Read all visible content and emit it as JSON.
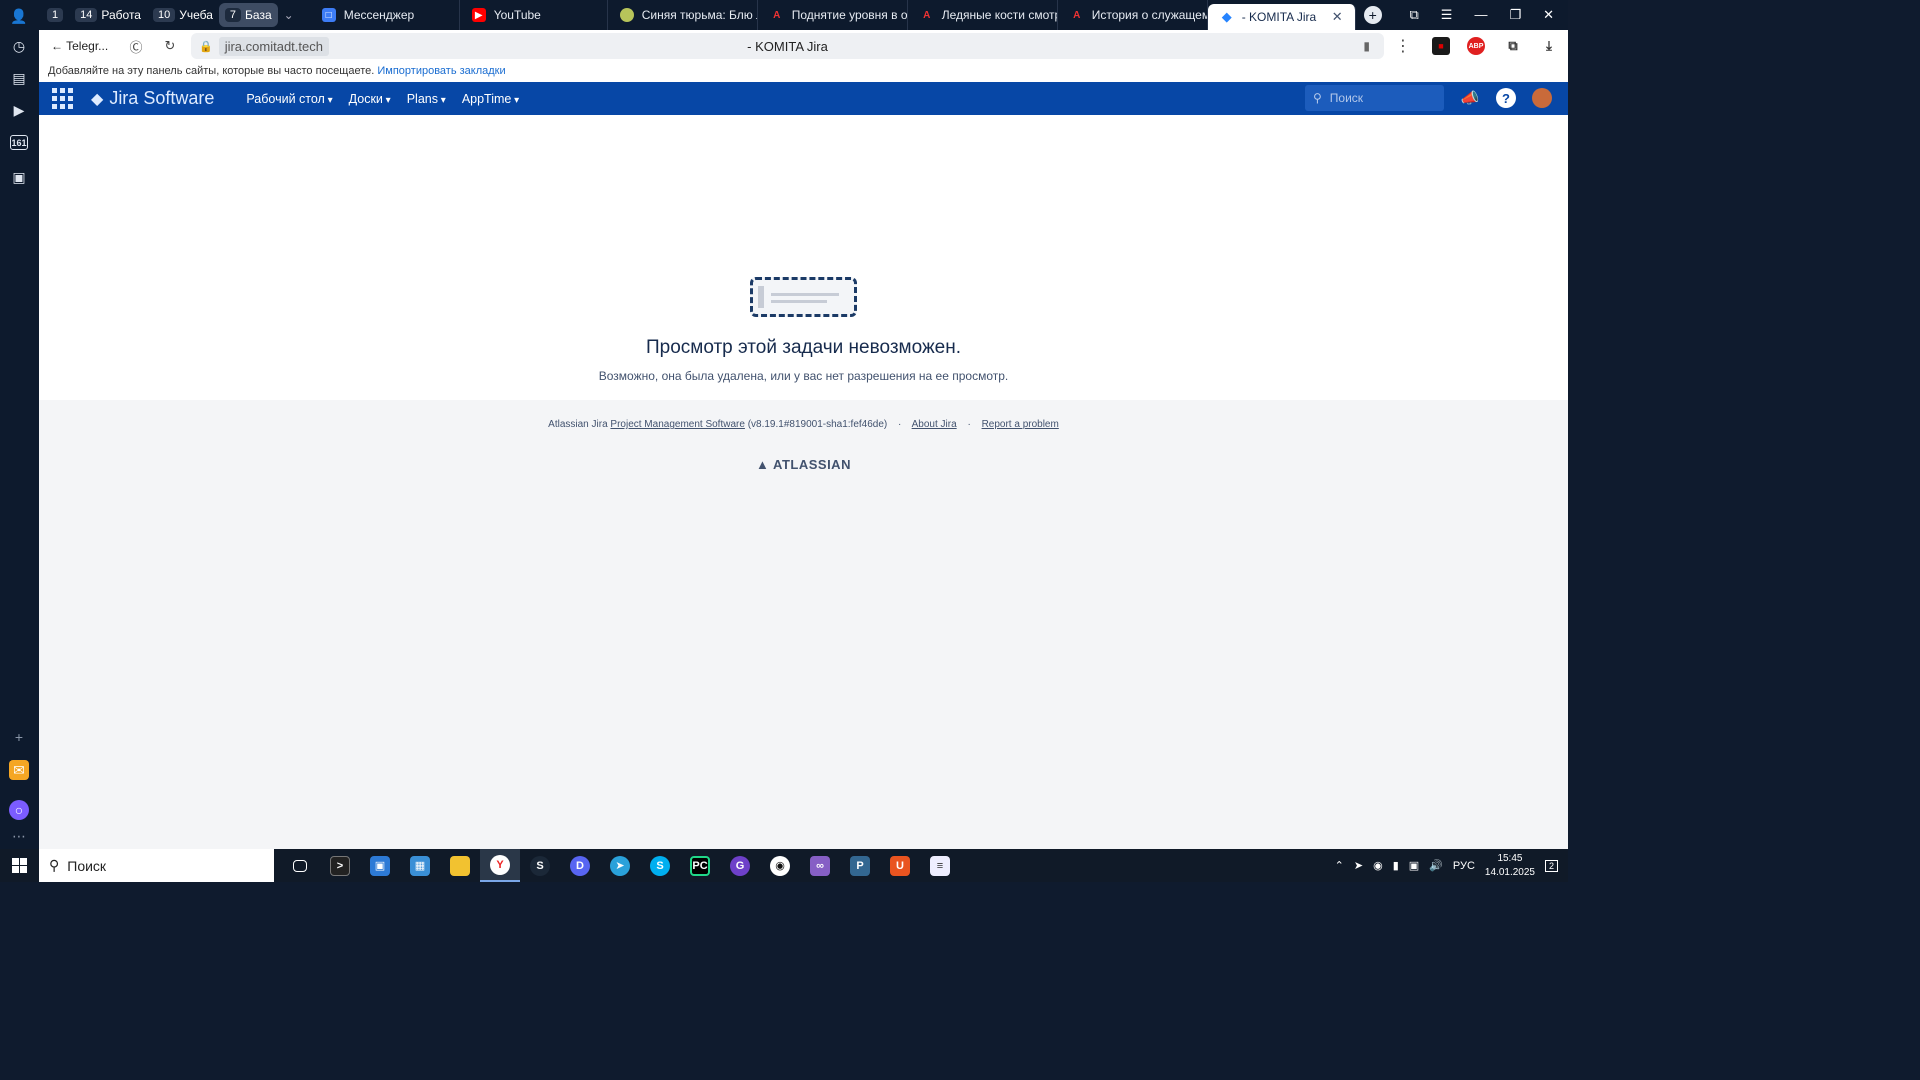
{
  "tabs": {
    "groups": [
      {
        "count": "1",
        "label": ""
      },
      {
        "count": "14",
        "label": "Работа"
      },
      {
        "count": "10",
        "label": "Учеба"
      },
      {
        "count": "7",
        "label": "База"
      }
    ],
    "items": [
      {
        "label": "Мессенджер"
      },
      {
        "label": "YouTube"
      },
      {
        "label": "Синяя тюрьма: Блю Ло"
      },
      {
        "label": "Поднятие уровня в од"
      },
      {
        "label": "Ледяные кости смотре"
      },
      {
        "label": "История о служащем."
      },
      {
        "label": "- KOMITA Jira"
      }
    ]
  },
  "addressbar": {
    "back_label": "Telegr...",
    "url": "jira.comitadt.tech",
    "page_title": "- KOMITA Jira",
    "sidebar_badge": "161",
    "abp_label": "ABP"
  },
  "bookmarks_bar": {
    "text": "Добавляйте на эту панель сайты, которые вы часто посещаете.",
    "link": "Импортировать закладки"
  },
  "jira": {
    "logo": "Jira Software",
    "nav": [
      "Рабочий стол",
      "Доски",
      "Plans",
      "AppTime"
    ],
    "search_placeholder": "Поиск"
  },
  "message": {
    "title": "Просмотр этой задачи невозможен.",
    "subtitle": "Возможно, она была удалена, или у вас нет разрешения на ее просмотр."
  },
  "footer": {
    "prefix": "Atlassian Jira",
    "pm_link": "Project Management Software",
    "version": "(v8.19.1#819001-sha1:fef46de)",
    "about": "About Jira",
    "report": "Report a problem",
    "brand": "ATLASSIAN"
  },
  "taskbar": {
    "search": "Поиск",
    "lang": "РУС",
    "time": "15:45",
    "date": "14.01.2025",
    "notifications": "2"
  }
}
